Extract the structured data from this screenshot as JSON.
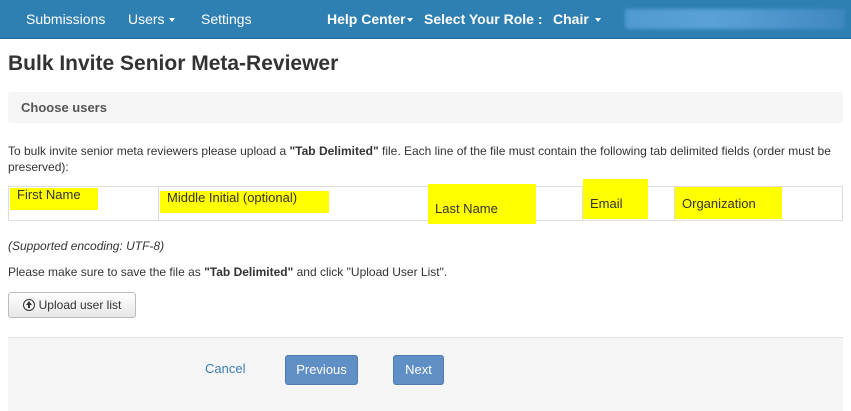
{
  "nav": {
    "submissions": "Submissions",
    "users": "Users",
    "settings": "Settings",
    "help_center": "Help Center",
    "select_role": "Select Your Role :",
    "role": "Chair"
  },
  "page": {
    "title": "Bulk Invite Senior Meta-Reviewer"
  },
  "panel": {
    "heading": "Choose users"
  },
  "instructions": {
    "prefix": "To bulk invite senior meta reviewers please upload a ",
    "format": "\"Tab Delimited\"",
    "suffix": " file. Each line of the file must contain the following tab delimited fields (order must be preserved):"
  },
  "fields": [
    "First Name",
    "Middle Initial (optional)",
    "Last Name",
    "Email",
    "Organization"
  ],
  "encoding_note": "(Supported encoding: UTF-8)",
  "save_note": {
    "prefix": "Please make sure to save the file as ",
    "format": "\"Tab Delimited\"",
    "suffix": " and click \"Upload User List\"."
  },
  "upload_button": "Upload user list",
  "footer": {
    "cancel": "Cancel",
    "previous": "Previous",
    "next": "Next"
  },
  "colors": {
    "navbar": "#2e7fb2",
    "highlight": "#ffff00",
    "primary_button": "#5f8fc4",
    "link": "#3a7fb6"
  }
}
